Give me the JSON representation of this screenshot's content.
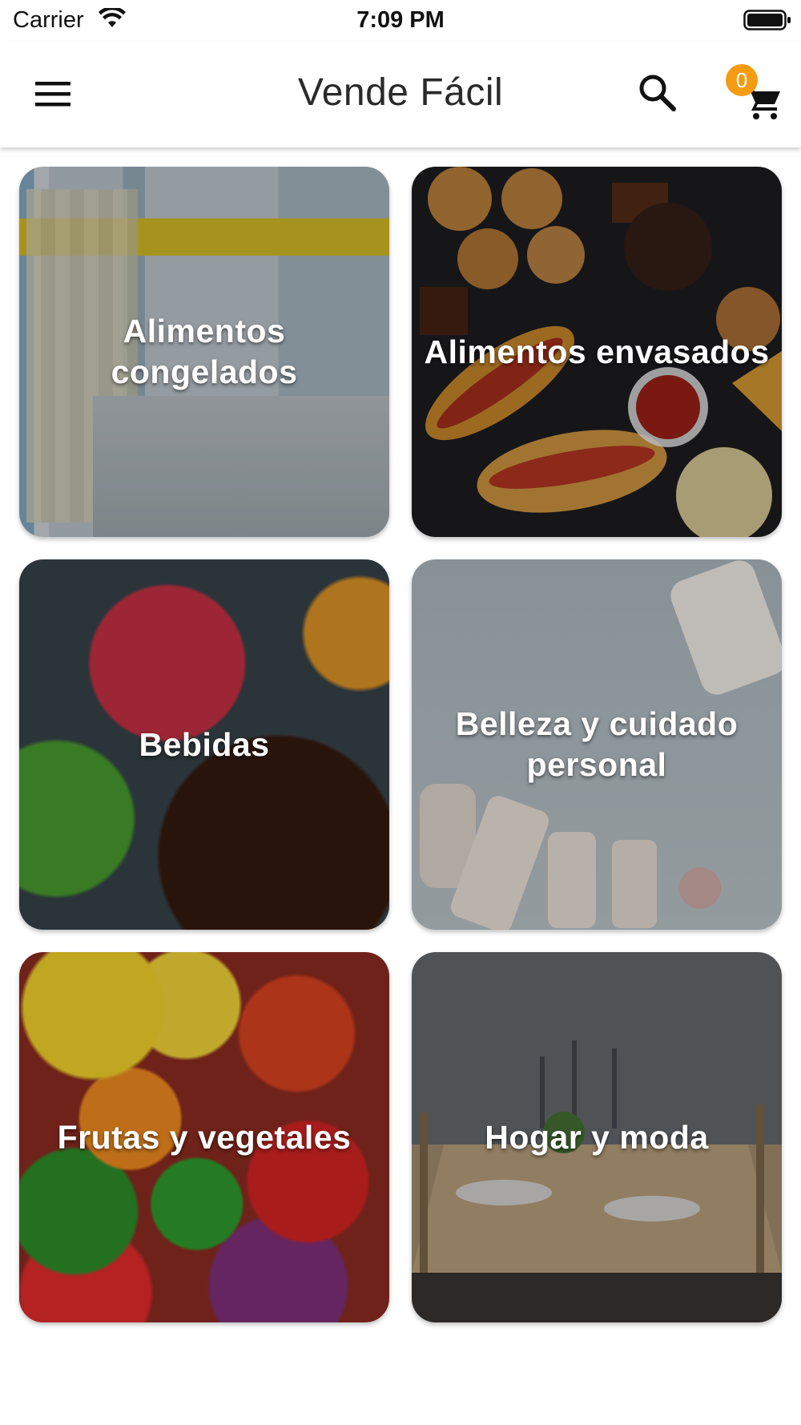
{
  "status_bar": {
    "carrier": "Carrier",
    "time": "7:09 PM",
    "wifi_icon": "wifi-icon",
    "battery_icon": "battery-full-icon"
  },
  "app_bar": {
    "title": "Vende Fácil",
    "menu_icon": "hamburger-menu-icon",
    "search_icon": "search-icon",
    "cart_icon": "shopping-cart-icon",
    "cart_count": "0",
    "badge_color": "#f39c12"
  },
  "categories": [
    {
      "label": "Alimentos congelados",
      "image": "frozen-food-aisle"
    },
    {
      "label": "Alimentos envasados",
      "image": "packaged-snacks"
    },
    {
      "label": "Bebidas",
      "image": "drinks"
    },
    {
      "label": "Belleza y cuidado personal",
      "image": "beauty-products"
    },
    {
      "label": "Frutas y vegetales",
      "image": "fruits-vegetables"
    },
    {
      "label": "Hogar y moda",
      "image": "dining-table"
    }
  ]
}
